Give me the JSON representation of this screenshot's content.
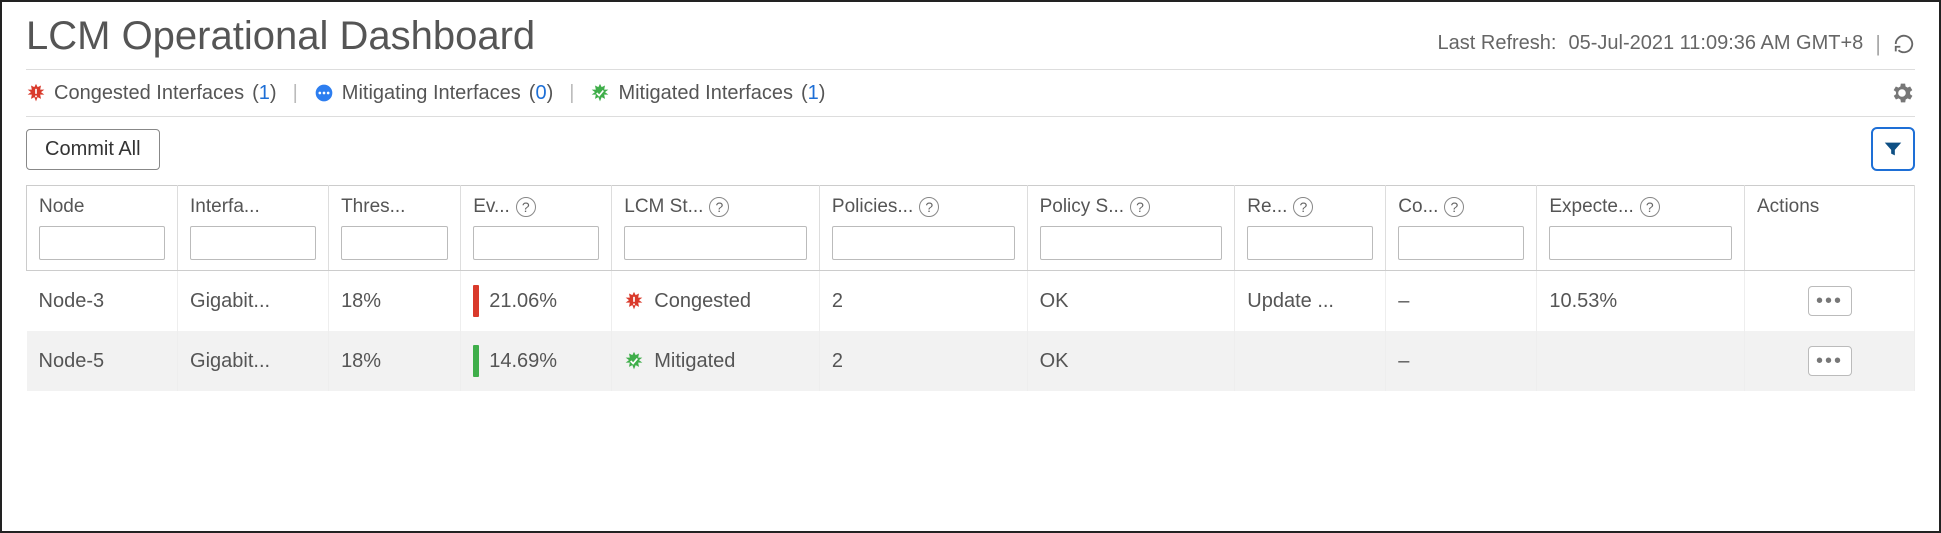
{
  "header": {
    "title": "LCM Operational Dashboard",
    "refresh_label": "Last Refresh:",
    "refresh_time": "05-Jul-2021 11:09:36 AM GMT+8"
  },
  "status": {
    "congested": {
      "label": "Congested Interfaces",
      "count": "1"
    },
    "mitigating": {
      "label": "Mitigating Interfaces",
      "count": "0"
    },
    "mitigated": {
      "label": "Mitigated Interfaces",
      "count": "1"
    }
  },
  "toolbar": {
    "commit_label": "Commit All"
  },
  "columns": {
    "node": "Node",
    "interface": "Interfa...",
    "threshold": "Thres...",
    "ev": "Ev...",
    "lcm_status": "LCM St...",
    "policies": "Policies...",
    "policy_s": "Policy S...",
    "re": "Re...",
    "co": "Co...",
    "expected": "Expecte...",
    "actions": "Actions"
  },
  "rows": [
    {
      "node": "Node-3",
      "interface": "Gigabit...",
      "threshold": "18%",
      "ev_bar": "red",
      "ev": "21.06%",
      "lcm_status_icon": "congested",
      "lcm_status": "Congested",
      "policies": "2",
      "policy_s": "OK",
      "re": "Update ...",
      "co": "–",
      "expected": "10.53%"
    },
    {
      "node": "Node-5",
      "interface": "Gigabit...",
      "threshold": "18%",
      "ev_bar": "green",
      "ev": "14.69%",
      "lcm_status_icon": "mitigated",
      "lcm_status": "Mitigated",
      "policies": "2",
      "policy_s": "OK",
      "re": "",
      "co": "–",
      "expected": ""
    }
  ]
}
